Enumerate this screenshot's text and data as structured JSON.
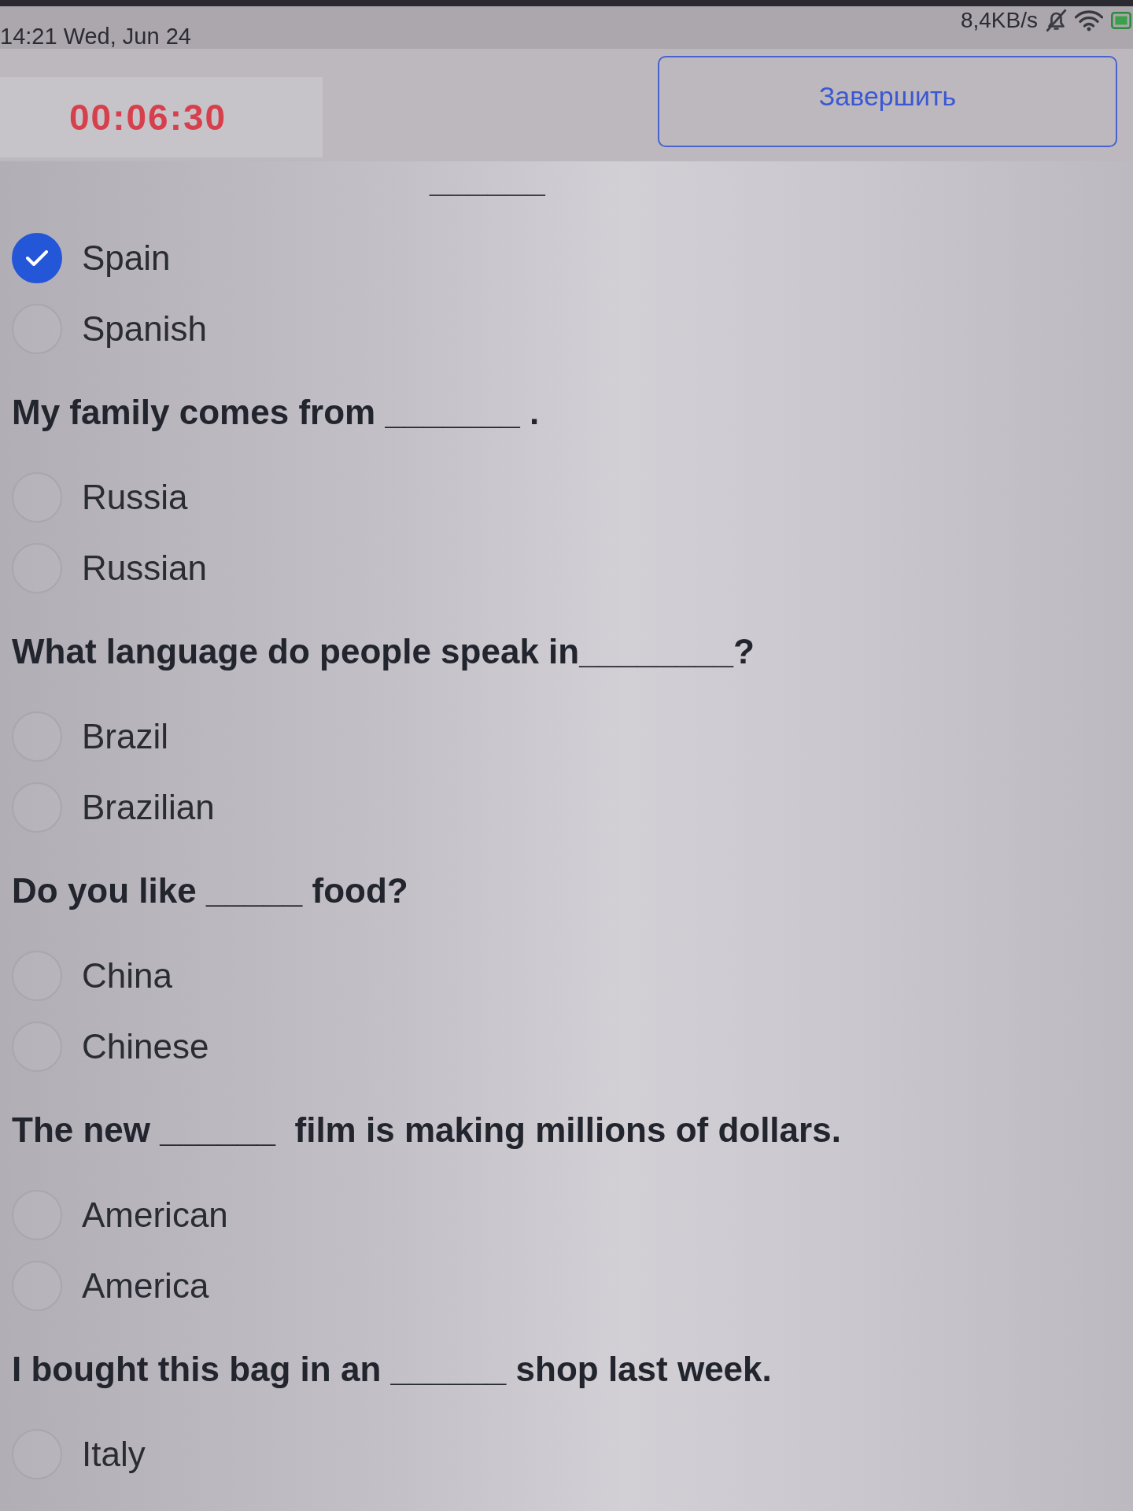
{
  "status_bar": {
    "time": "14:21 Wed, Jun 24",
    "network_speed": "8,4KB/s"
  },
  "header": {
    "timer": "00:06:30",
    "finish_button": "Завершить"
  },
  "questions": [
    {
      "text": "______",
      "partly_hidden": true,
      "options": [
        {
          "label": "Spain",
          "selected": true
        },
        {
          "label": "Spanish",
          "selected": false
        }
      ]
    },
    {
      "text": "My family comes from _______ .",
      "partly_hidden": false,
      "options": [
        {
          "label": "Russia",
          "selected": false
        },
        {
          "label": "Russian",
          "selected": false
        }
      ]
    },
    {
      "text": "What language do people speak in________?",
      "partly_hidden": false,
      "options": [
        {
          "label": "Brazil",
          "selected": false
        },
        {
          "label": "Brazilian",
          "selected": false
        }
      ]
    },
    {
      "text": "Do you like _____ food?",
      "partly_hidden": false,
      "options": [
        {
          "label": "China",
          "selected": false
        },
        {
          "label": "Chinese",
          "selected": false
        }
      ]
    },
    {
      "text": "The new ______  film is making millions of dollars.",
      "partly_hidden": false,
      "options": [
        {
          "label": "American",
          "selected": false
        },
        {
          "label": "America",
          "selected": false
        }
      ]
    },
    {
      "text": "I bought this bag in an ______ shop last week.",
      "partly_hidden": false,
      "options": [
        {
          "label": "Italy",
          "selected": false
        }
      ]
    }
  ]
}
